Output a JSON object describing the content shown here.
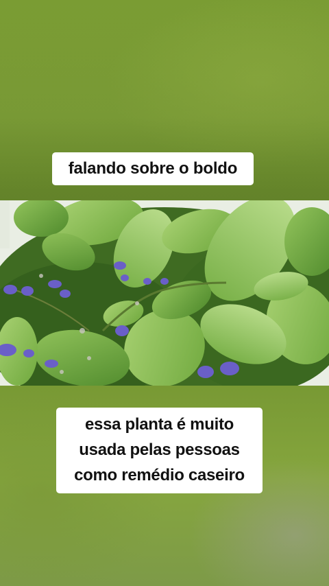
{
  "video": {
    "top_caption": "falando sobre o boldo",
    "bottom_caption_lines": [
      "essa planta é muito",
      "usada pelas pessoas",
      "como remédio caseiro"
    ]
  },
  "colors": {
    "background_green": "#7a9c33",
    "caption_bg": "#ffffff",
    "caption_text": "#111111",
    "leaf_green": "#8fc25a",
    "flower_purple": "#6a5fc8"
  },
  "photo": {
    "subject": "boldo-plant-icon"
  }
}
